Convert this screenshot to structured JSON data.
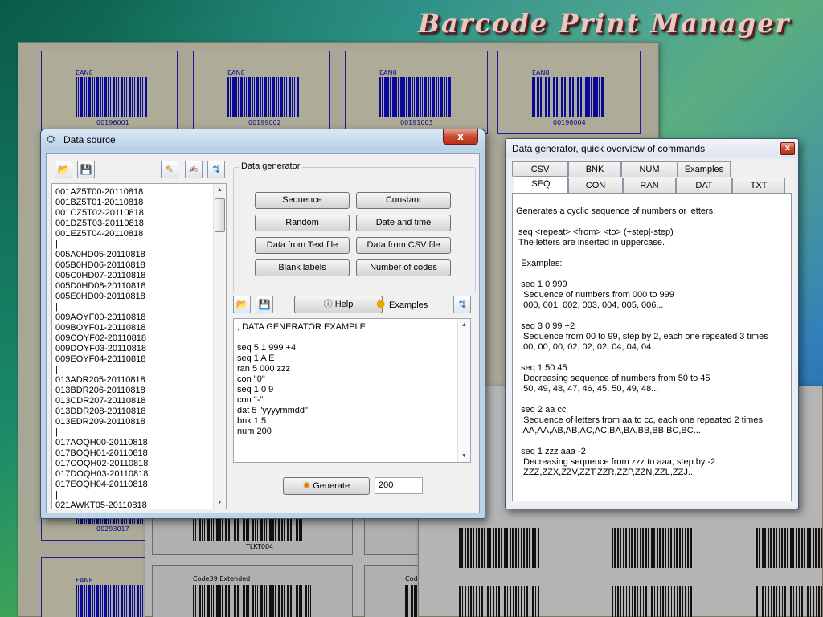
{
  "app": {
    "title": "Barcode Print Manager"
  },
  "background_sheets": {
    "top_labels": [
      {
        "kind": "EAN8",
        "code": "00196001"
      },
      {
        "kind": "EAN8",
        "code": "00199002"
      },
      {
        "kind": "EAN8",
        "code": "00191003"
      },
      {
        "kind": "EAN8",
        "code": "00198004"
      }
    ],
    "bottom_left_label": {
      "kind": "EAN8",
      "code": "00293017"
    },
    "bottom_left_label2": {
      "kind": "EAN8"
    },
    "middle_cards": [
      {
        "kind": "",
        "code": "TLKT004"
      },
      {
        "kind": "Code39 Extended",
        "code": ""
      },
      {
        "kind": "Code",
        "code": ""
      }
    ]
  },
  "data_source_window": {
    "title": "Data source",
    "close_label": "x",
    "codes": [
      "001AZ5T00-20110818",
      "001BZ5T01-20110818",
      "001CZ5T02-20110818",
      "001DZ5T03-20110818",
      "001EZ5T04-20110818",
      "|",
      "005A0HD05-20110818",
      "005B0HD06-20110818",
      "005C0HD07-20110818",
      "005D0HD08-20110818",
      "005E0HD09-20110818",
      "|",
      "009AOYF00-20110818",
      "009BOYF01-20110818",
      "009COYF02-20110818",
      "009DOYF03-20110818",
      "009EOYF04-20110818",
      "|",
      "013ADR205-20110818",
      "013BDR206-20110818",
      "013CDR207-20110818",
      "013DDR208-20110818",
      "013EDR209-20110818",
      "|",
      "017AOQH00-20110818",
      "017BOQH01-20110818",
      "017COQH02-20110818",
      "017DOQH03-20110818",
      "017EOQH04-20110818",
      "|",
      "021AWKT05-20110818"
    ],
    "generator": {
      "group_title": "Data generator",
      "buttons": [
        "Sequence",
        "Constant",
        "Random",
        "Date and time",
        "Data from Text file",
        "Data from CSV file",
        "Blank labels",
        "Number of codes"
      ],
      "help_label": "Help",
      "examples_label": "Examples",
      "script_lines": [
        "; DATA GENERATOR EXAMPLE",
        "",
        "seq 5 1 999 +4",
        "seq 1 A E",
        "ran 5 000 zzz",
        "con \"0\"",
        "seq 1 0 9",
        "con \"-\"",
        "dat 5 \"yyyymmdd\"",
        "bnk 1 5",
        "num 200"
      ],
      "generate_label": "Generate",
      "count_value": "200"
    }
  },
  "overview_window": {
    "title": "Data generator, quick overview of commands",
    "close_label": "x",
    "tabs_row1": [
      "CSV",
      "BNK",
      "NUM",
      "Examples"
    ],
    "tabs_row2": [
      "SEQ",
      "CON",
      "RAN",
      "DAT",
      "TXT"
    ],
    "active_tab": "SEQ",
    "content_lines": [
      "Generates a cyclic sequence of numbers or letters.",
      "",
      " seq <repeat> <from> <to> (+step|-step)",
      " The letters are inserted in uppercase.",
      "",
      "  Examples:",
      "",
      "  seq 1 0 999",
      "   Sequence of numbers from 000 to 999",
      "   000, 001, 002, 003, 004, 005, 006...",
      "",
      "  seq 3 0 99 +2",
      "   Sequence from 00 to 99, step by 2, each one repeated 3 times",
      "   00, 00, 00, 02, 02, 02, 04, 04, 04...",
      "",
      "  seq 1 50 45",
      "   Decreasing sequence of numbers from 50 to 45",
      "   50, 49, 48, 47, 46, 45, 50, 49, 48...",
      "",
      "  seq 2 aa cc",
      "   Sequence of letters from aa to cc, each one repeated 2 times",
      "   AA,AA,AB,AB,AC,AC,BA,BA,BB,BB,BC,BC...",
      "",
      "  seq 1 zzz aaa -2",
      "   Decreasing sequence from zzz to aaa, step by -2",
      "   ZZZ,ZZX,ZZV,ZZT,ZZR,ZZP,ZZN,ZZL,ZZJ..."
    ]
  }
}
